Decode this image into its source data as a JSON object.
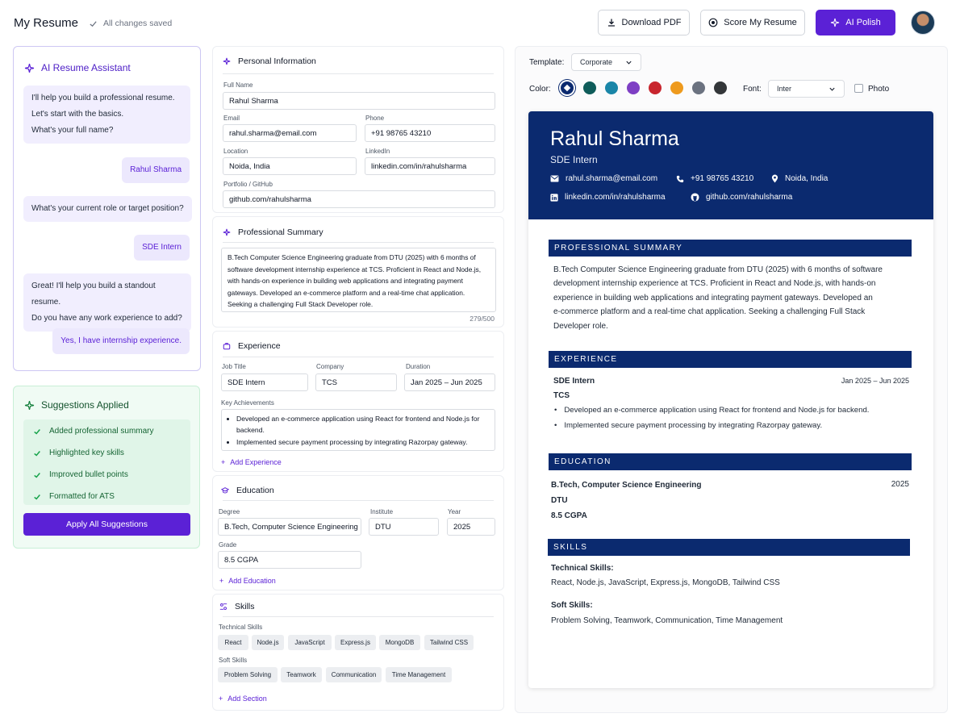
{
  "header": {
    "title": "My Resume",
    "saved_status": "All changes saved",
    "download_label": "Download PDF",
    "score_label": "Score My Resume",
    "polish_label": "AI Polish"
  },
  "assistant": {
    "title": "AI Resume Assistant",
    "messages": [
      {
        "from": "ai",
        "lines": [
          "I'll help you build a professional resume.",
          "Let's start with the basics.",
          "What's your full name?"
        ]
      },
      {
        "from": "user",
        "text": "Rahul Sharma"
      },
      {
        "from": "ai",
        "lines": [
          "What's your current role or target position?"
        ]
      },
      {
        "from": "user",
        "text": "SDE Intern"
      },
      {
        "from": "ai",
        "lines": [
          "Great! I'll help you build a standout resume.",
          "Do you have any work experience to add?"
        ]
      },
      {
        "from": "user",
        "text": "Yes, I have internship experience."
      }
    ]
  },
  "suggestions": {
    "title": "Suggestions Applied",
    "items": [
      "Added professional summary",
      "Highlighted key skills",
      "Improved bullet points",
      "Formatted for ATS"
    ],
    "apply_label": "Apply All Suggestions"
  },
  "personal": {
    "title": "Personal Information",
    "full_name_label": "Full Name",
    "full_name": "Rahul Sharma",
    "email_label": "Email",
    "email": "rahul.sharma@email.com",
    "phone_label": "Phone",
    "phone": "+91 98765 43210",
    "location_label": "Location",
    "location": "Noida, India",
    "linkedin_label": "LinkedIn",
    "linkedin": "linkedin.com/in/rahulsharma",
    "portfolio_label": "Portfolio / GitHub",
    "portfolio": "github.com/rahulsharma"
  },
  "summary": {
    "title": "Professional Summary",
    "lines": [
      "B.Tech Computer Science Engineering graduate from DTU (2025) with 6 months of",
      "software development internship experience at TCS. Proficient in React and Node.js,",
      "with hands-on experience in building web applications and integrating payment",
      "gateways. Developed an e-commerce platform and a real-time chat application.",
      "Seeking a challenging Full Stack Developer role."
    ],
    "counter": "279/500"
  },
  "experience": {
    "title": "Experience",
    "job_title_label": "Job Title",
    "job_title": "SDE Intern",
    "company_label": "Company",
    "company": "TCS",
    "duration_label": "Duration",
    "duration": "Jan 2025 – Jun 2025",
    "achievements_label": "Key Achievements",
    "achievements": [
      "Developed an e-commerce application using React for frontend and Node.js for backend.",
      "Implemented secure payment processing by integrating Razorpay gateway."
    ],
    "add_label": "Add Experience"
  },
  "education": {
    "title": "Education",
    "degree_label": "Degree",
    "degree": "B.Tech, Computer Science Engineering",
    "institute_label": "Institute",
    "institute": "DTU",
    "year_label": "Year",
    "year": "2025",
    "grade_label": "Grade",
    "grade": "8.5 CGPA",
    "add_label": "Add Education"
  },
  "skills": {
    "title": "Skills",
    "technical_label": "Technical Skills",
    "technical": [
      "React",
      "Node.js",
      "JavaScript",
      "Express.js",
      "MongoDB",
      "Tailwind CSS"
    ],
    "soft_label": "Soft Skills",
    "soft": [
      "Problem Solving",
      "Teamwork",
      "Communication",
      "Time Management"
    ],
    "add_label": "Add Section"
  },
  "controls": {
    "template_label": "Template:",
    "template_value": "Corporate",
    "color_label": "Color:",
    "colors": [
      "#0b2a6f",
      "#0f5c5a",
      "#1a86a8",
      "#7e3fc4",
      "#c8262e",
      "#ee9a1d",
      "#6b7280",
      "#333639"
    ],
    "font_label": "Font:",
    "font_value": "Inter",
    "photo_label": "Photo"
  },
  "resume": {
    "name": "Rahul Sharma",
    "role": "SDE Intern",
    "email": "rahul.sharma@email.com",
    "phone": "+91 98765 43210",
    "location": "Noida, India",
    "linkedin": "linkedin.com/in/rahulsharma",
    "github": "github.com/rahulsharma",
    "summary_heading": "PROFESSIONAL SUMMARY",
    "summary_lines": [
      "B.Tech Computer Science Engineering graduate from DTU (2025) with 6 months of software",
      "development internship experience at TCS. Proficient in React and Node.js, with hands-on",
      "experience in building web applications and integrating payment gateways. Developed an",
      "e-commerce platform and a real-time chat application. Seeking a challenging Full Stack",
      "Developer role."
    ],
    "experience_heading": "EXPERIENCE",
    "exp_title": "SDE Intern",
    "exp_dates": "Jan 2025 – Jun 2025",
    "exp_company": "TCS",
    "exp_bullets": [
      "Developed an e-commerce application using React for frontend and Node.js for backend.",
      "Implemented secure payment processing by integrating Razorpay gateway."
    ],
    "education_heading": "EDUCATION",
    "edu_degree": "B.Tech, Computer Science Engineering",
    "edu_year": "2025",
    "edu_school": "DTU",
    "edu_grade": "8.5 CGPA",
    "skills_heading": "SKILLS",
    "tech_label": "Technical Skills:",
    "tech_list": "React, Node.js, JavaScript, Express.js, MongoDB, Tailwind CSS",
    "soft_label": "Soft Skills:",
    "soft_list": "Problem Solving, Teamwork, Communication, Time Management"
  }
}
